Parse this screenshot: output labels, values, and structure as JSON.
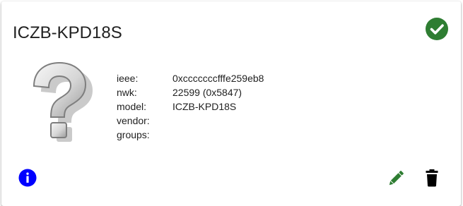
{
  "device": {
    "title": "ICZB-KPD18S",
    "status_icon": "check-circle-icon",
    "status_color": "#2e7d32",
    "image_icon": "question-mark-icon"
  },
  "details": [
    {
      "label": "ieee:",
      "value": "0xcccccccfffe259eb8"
    },
    {
      "label": "nwk:",
      "value": "22599 (0x5847)"
    },
    {
      "label": "model:",
      "value": "ICZB-KPD18S"
    },
    {
      "label": "vendor:",
      "value": ""
    },
    {
      "label": "groups:",
      "value": ""
    }
  ],
  "actions": {
    "info_icon": "info-icon",
    "info_color": "#0000ff",
    "edit_icon": "pencil-icon",
    "edit_color": "#2e7d32",
    "delete_icon": "trash-icon",
    "delete_color": "#000000"
  }
}
